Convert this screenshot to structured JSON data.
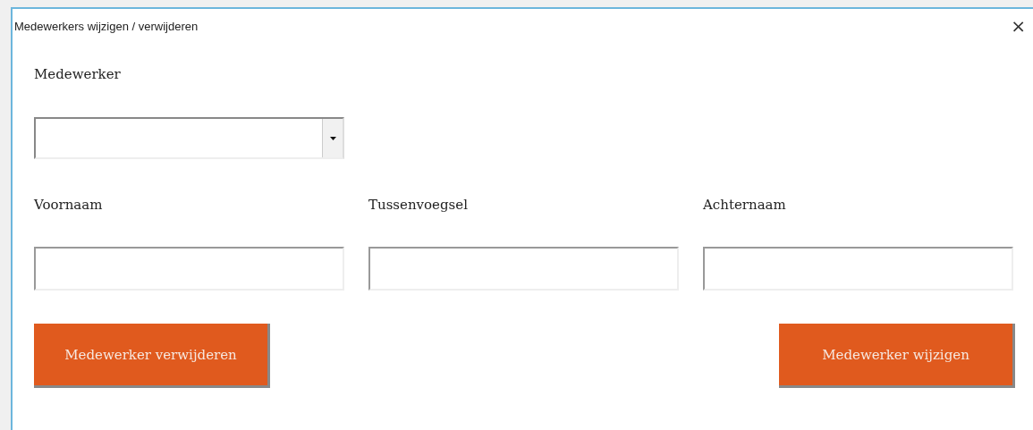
{
  "window": {
    "title": "Medewerkers wijzigen / verwijderen",
    "close": "×"
  },
  "employee": {
    "label": "Medewerker"
  },
  "fields": [
    {
      "label": "Voornaam"
    },
    {
      "label": "Tussenvoegsel"
    },
    {
      "label": "Achternaam"
    }
  ],
  "buttons": [
    {
      "label": "Medewerker verwijderen"
    },
    {
      "label": "Medewerker wijzigen"
    }
  ]
}
